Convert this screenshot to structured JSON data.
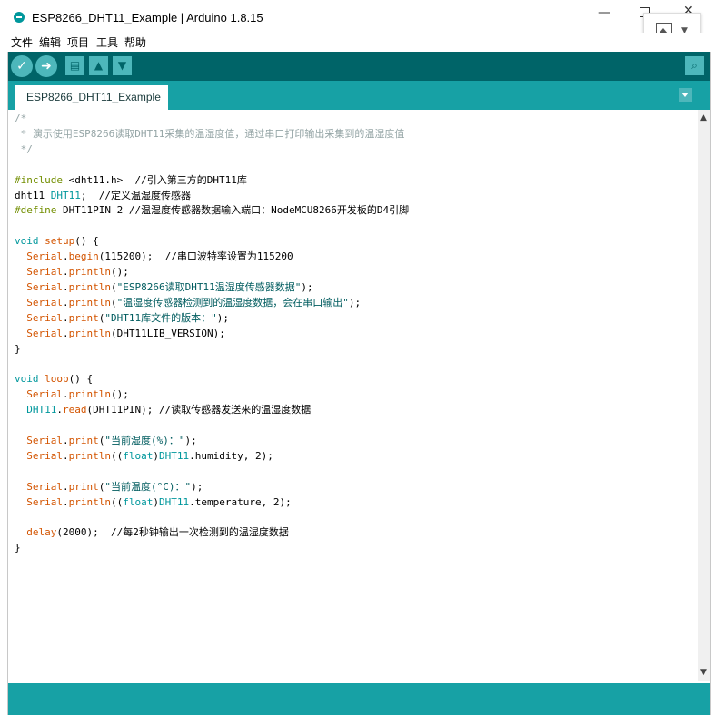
{
  "window": {
    "title": "ESP8266_DHT11_Example | Arduino 1.8.15"
  },
  "menu": [
    "文件",
    "编辑",
    "项目",
    "工具",
    "帮助"
  ],
  "toolbar": {
    "verify_icon": "checkmark-icon",
    "upload_icon": "arrow-right-icon",
    "new_icon": "new-file-icon",
    "open_icon": "open-arrow-up-icon",
    "save_icon": "save-arrow-down-icon",
    "serial_icon": "magnifier-icon"
  },
  "tabs": [
    {
      "label": "ESP8266_DHT11_Example"
    }
  ],
  "code": [
    "/*",
    " * 演示使用ESP8266读取DHT11采集的温湿度值，通过串口打印输出采集到的温湿度值",
    " */",
    "",
    "#include <dht11.h>  //引入第三方的DHT11库",
    "dht11 DHT11;  //定义温湿度传感器",
    "#define DHT11PIN 2 //温湿度传感器数据输入端口：NodeMCU8266开发板的D4引脚",
    "",
    "void setup() {",
    "  Serial.begin(115200);  //串口波特率设置为115200",
    "  Serial.println();",
    "  Serial.println(\"ESP8266读取DHT11温湿度传感器数据\");",
    "  Serial.println(\"温湿度传感器检测到的温湿度数据，会在串口输出\");",
    "  Serial.print(\"DHT11库文件的版本：\");",
    "  Serial.println(DHT11LIB_VERSION);",
    "}",
    "",
    "void loop() {",
    "  Serial.println();",
    "  DHT11.read(DHT11PIN); //读取传感器发送来的温湿度数据",
    "",
    "  Serial.print(\"当前湿度(%)：\");",
    "  Serial.println((float)DHT11.humidity, 2);",
    "",
    "  Serial.print(\"当前温度(°C)：\");",
    "  Serial.println((float)DHT11.temperature, 2);",
    "",
    "  delay(2000);  //每2秒钟输出一次检测到的温湿度数据",
    "}"
  ],
  "colors": {
    "toolbar": "#006468",
    "tabbar": "#17a1a5",
    "button": "#4db7bb",
    "comment": "#95a5a6",
    "keyword": "#728e00",
    "type": "#00979c",
    "function": "#d35400",
    "string": "#005c5f"
  }
}
